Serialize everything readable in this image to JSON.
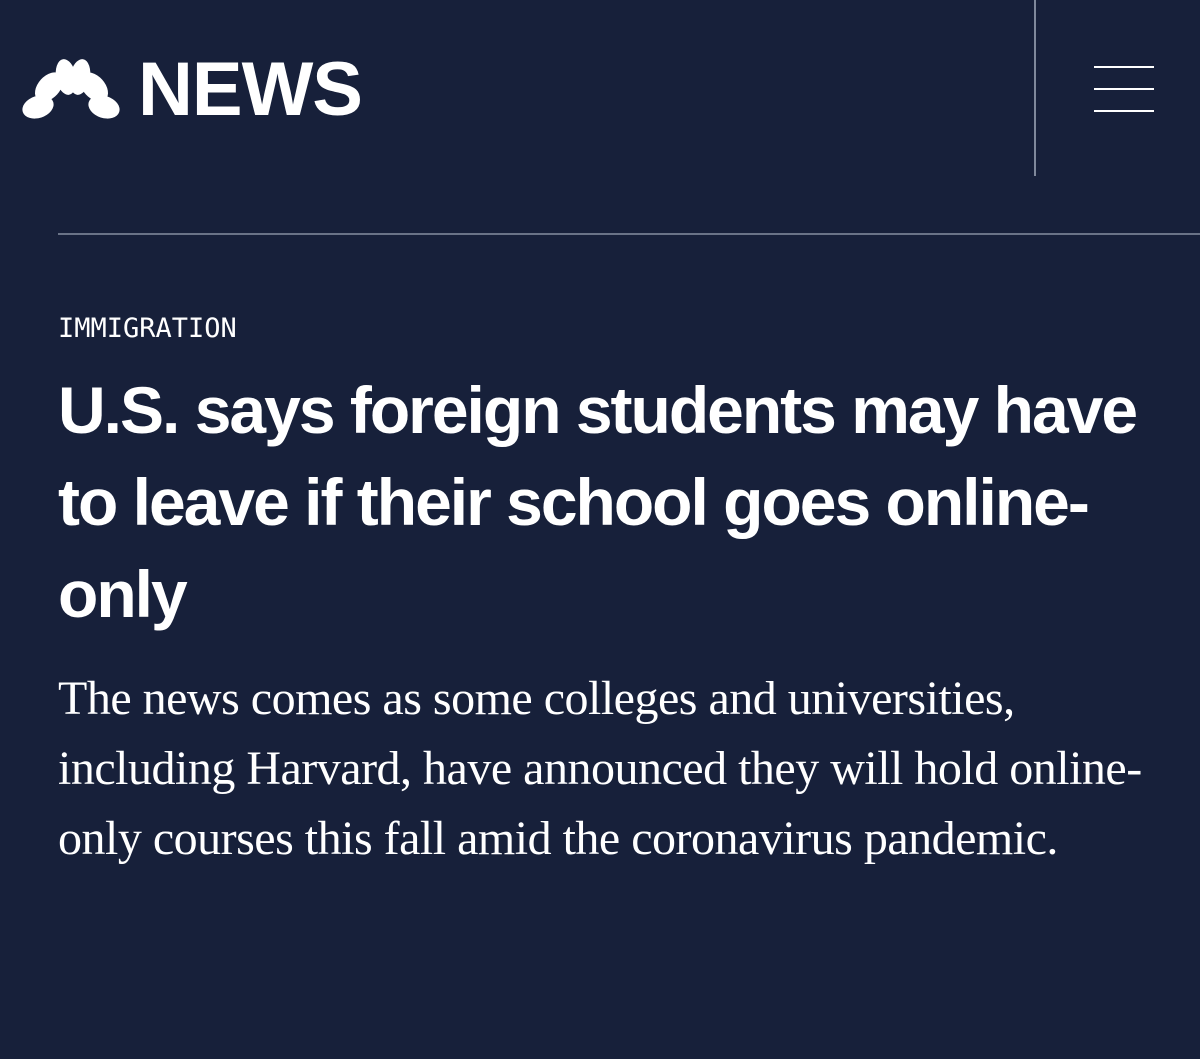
{
  "header": {
    "logo_text": "NEWS",
    "menu_icon": "hamburger-menu-icon",
    "brand_logo": "peacock-logo-icon"
  },
  "article": {
    "kicker": "IMMIGRATION",
    "headline": "U.S. says foreign students may have to leave if their school goes online-only",
    "dek": "The news comes as some colleges and universities, including Harvard, have announced they will hold online-only courses this fall amid the coronavirus pandemic."
  },
  "colors": {
    "background": "#17203a",
    "text": "#ffffff",
    "divider": "#6a7387"
  }
}
